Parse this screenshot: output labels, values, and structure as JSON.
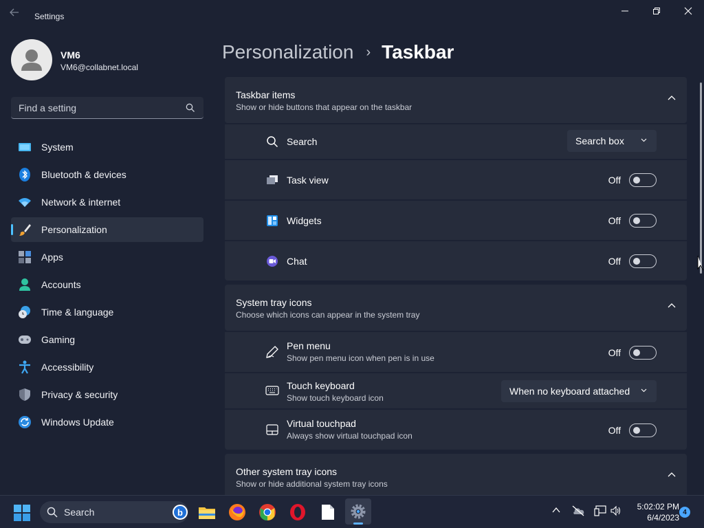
{
  "window": {
    "title": "Settings",
    "controls": [
      "minimize",
      "restore",
      "close"
    ]
  },
  "profile": {
    "name": "VM6",
    "email": "VM6@collabnet.local"
  },
  "search": {
    "placeholder": "Find a setting"
  },
  "sidebar": {
    "items": [
      {
        "label": "System",
        "icon": "system-icon"
      },
      {
        "label": "Bluetooth & devices",
        "icon": "bluetooth-icon"
      },
      {
        "label": "Network & internet",
        "icon": "wifi-icon"
      },
      {
        "label": "Personalization",
        "icon": "brush-icon",
        "active": true
      },
      {
        "label": "Apps",
        "icon": "apps-icon"
      },
      {
        "label": "Accounts",
        "icon": "accounts-icon"
      },
      {
        "label": "Time & language",
        "icon": "clock-globe-icon"
      },
      {
        "label": "Gaming",
        "icon": "gamepad-icon"
      },
      {
        "label": "Accessibility",
        "icon": "accessibility-icon"
      },
      {
        "label": "Privacy & security",
        "icon": "shield-icon"
      },
      {
        "label": "Windows Update",
        "icon": "update-icon"
      }
    ]
  },
  "header": {
    "parent": "Personalization",
    "separator": "›",
    "current": "Taskbar"
  },
  "sections": {
    "taskbar_items": {
      "title": "Taskbar items",
      "subtitle": "Show or hide buttons that appear on the taskbar",
      "expanded": true,
      "rows": {
        "search": {
          "label": "Search",
          "value": "Search box"
        },
        "task_view": {
          "label": "Task view",
          "state": "Off"
        },
        "widgets": {
          "label": "Widgets",
          "state": "Off"
        },
        "chat": {
          "label": "Chat",
          "state": "Off"
        }
      }
    },
    "system_tray": {
      "title": "System tray icons",
      "subtitle": "Choose which icons can appear in the system tray",
      "expanded": true,
      "rows": {
        "pen_menu": {
          "label": "Pen menu",
          "sub": "Show pen menu icon when pen is in use",
          "state": "Off"
        },
        "touch_keyboard": {
          "label": "Touch keyboard",
          "sub": "Show touch keyboard icon",
          "value": "When no keyboard attached"
        },
        "virtual_touchpad": {
          "label": "Virtual touchpad",
          "sub": "Always show virtual touchpad icon",
          "state": "Off"
        }
      }
    },
    "other_tray": {
      "title": "Other system tray icons",
      "subtitle": "Show or hide additional system tray icons",
      "expanded": true
    }
  },
  "taskbar": {
    "search_label": "Search",
    "bing_letter": "b",
    "apps": [
      "file-explorer-icon",
      "firefox-icon",
      "chrome-icon",
      "opera-icon",
      "notepad-icon",
      "settings-icon"
    ],
    "time": "5:02:02 PM",
    "date": "6/4/2023",
    "notification_count": "4"
  },
  "colors": {
    "accent": "#4cc2ff",
    "background": "#1c2233",
    "card": "#262c3b"
  }
}
